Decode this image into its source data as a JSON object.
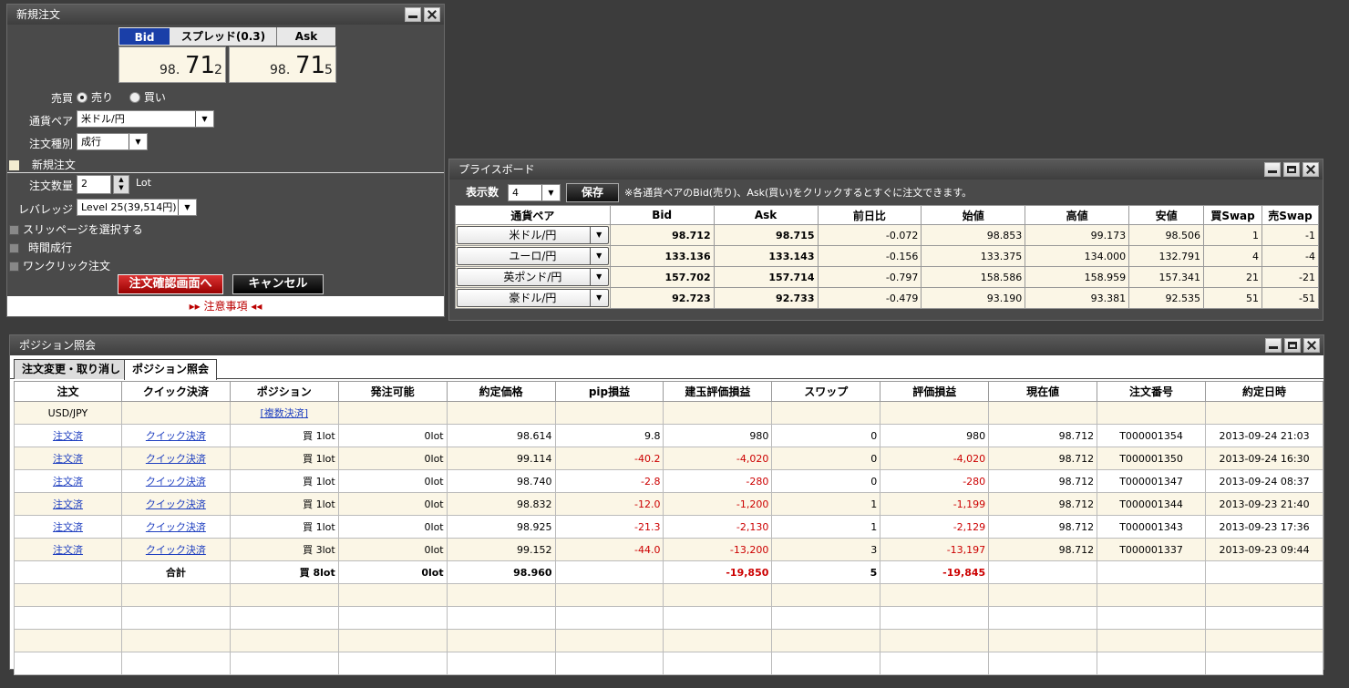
{
  "order": {
    "title": "新規注文",
    "bid_label": "Bid",
    "spread_label": "スプレッド(0.3)",
    "ask_label": "Ask",
    "bid": {
      "small": "98.",
      "big": "71",
      "tail": "2"
    },
    "ask": {
      "small": "98.",
      "big": "71",
      "tail": "5"
    },
    "side_label": "売買",
    "sell_label": "売り",
    "buy_label": "買い",
    "pair_label": "通貨ペア",
    "pair_value": "米ドル/円",
    "type_label": "注文種別",
    "type_value": "成行",
    "section_label": "新規注文",
    "qty_label": "注文数量",
    "qty_value": "2",
    "qty_unit": "Lot",
    "leverage_label": "レバレッジ",
    "leverage_value": "Level 25(39,514円)",
    "slippage_label": "スリッページを選択する",
    "timed_label": "時間成行",
    "oneclick_label": "ワンクリック注文",
    "confirm_label": "注文確認画面へ",
    "cancel_label": "キャンセル",
    "notice": "▸▸ 注意事項 ◂◂"
  },
  "board": {
    "title": "プライスボード",
    "count_label": "表示数",
    "count_value": "4",
    "save_label": "保存",
    "hint": "※各通貨ペアのBid(売り)、Ask(買い)をクリックするとすぐに注文できます。",
    "columns": [
      "通貨ペア",
      "Bid",
      "Ask",
      "前日比",
      "始値",
      "高値",
      "安値",
      "買Swap",
      "売Swap"
    ],
    "rows": [
      [
        "米ドル/円",
        "98.712",
        "98.715",
        "-0.072",
        "98.853",
        "99.173",
        "98.506",
        "1",
        "-1"
      ],
      [
        "ユーロ/円",
        "133.136",
        "133.143",
        "-0.156",
        "133.375",
        "134.000",
        "132.791",
        "4",
        "-4"
      ],
      [
        "英ポンド/円",
        "157.702",
        "157.714",
        "-0.797",
        "158.586",
        "158.959",
        "157.341",
        "21",
        "-21"
      ],
      [
        "豪ドル/円",
        "92.723",
        "92.733",
        "-0.479",
        "93.190",
        "93.381",
        "92.535",
        "51",
        "-51"
      ]
    ]
  },
  "positions": {
    "title": "ポジション照会",
    "tabs": [
      "注文変更・取り消し",
      "ポジション照会"
    ],
    "columns": [
      "注文",
      "クイック決済",
      "ポジション",
      "発注可能",
      "約定価格",
      "pip損益",
      "建玉評価損益",
      "スワップ",
      "評価損益",
      "現在値",
      "注文番号",
      "約定日時"
    ],
    "group": {
      "pair": "USD/JPY",
      "multi": "[複数決済]"
    },
    "rows": [
      [
        "注文済",
        "クイック決済",
        "買 1lot",
        "0lot",
        "98.614",
        "9.8",
        "980",
        "0",
        "980",
        "98.712",
        "T000001354",
        "2013-09-24 21:03"
      ],
      [
        "注文済",
        "クイック決済",
        "買 1lot",
        "0lot",
        "99.114",
        "-40.2",
        "-4,020",
        "0",
        "-4,020",
        "98.712",
        "T000001350",
        "2013-09-24 16:30"
      ],
      [
        "注文済",
        "クイック決済",
        "買 1lot",
        "0lot",
        "98.740",
        "-2.8",
        "-280",
        "0",
        "-280",
        "98.712",
        "T000001347",
        "2013-09-24 08:37"
      ],
      [
        "注文済",
        "クイック決済",
        "買 1lot",
        "0lot",
        "98.832",
        "-12.0",
        "-1,200",
        "1",
        "-1,199",
        "98.712",
        "T000001344",
        "2013-09-23 21:40"
      ],
      [
        "注文済",
        "クイック決済",
        "買 1lot",
        "0lot",
        "98.925",
        "-21.3",
        "-2,130",
        "1",
        "-2,129",
        "98.712",
        "T000001343",
        "2013-09-23 17:36"
      ],
      [
        "注文済",
        "クイック決済",
        "買 3lot",
        "0lot",
        "99.152",
        "-44.0",
        "-13,200",
        "3",
        "-13,197",
        "98.712",
        "T000001337",
        "2013-09-23 09:44"
      ]
    ],
    "total": {
      "label": "合計",
      "position": "買 8lot",
      "available": "0lot",
      "price": "98.960",
      "eval_pl": "-19,850",
      "swap": "5",
      "pl": "-19,845"
    }
  }
}
